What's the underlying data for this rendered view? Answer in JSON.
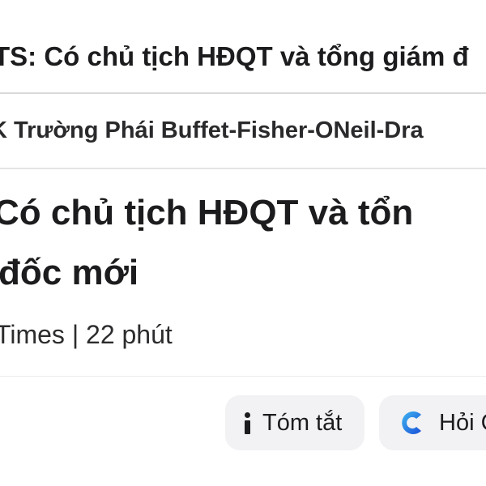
{
  "nav": {
    "title": "TS: Có chủ tịch HĐQT và tổng giám đ"
  },
  "source": {
    "label": "K Trường Phái Buffet-Fisher-ONeil-Dra"
  },
  "article": {
    "headline_line1": "Có chủ tịch HĐQT và tổn",
    "headline_line2": "đốc mới",
    "meta": "Times | 22 phút"
  },
  "actions": {
    "summary_label": "Tóm tắt",
    "ask_label": "Hỏi C",
    "summary_icon": "info-icon",
    "ask_icon": "c-logo-icon"
  },
  "colors": {
    "accent_blue": "#1a73e8",
    "accent_cyan": "#3fb6f0",
    "button_bg": "#f2f2f4"
  }
}
